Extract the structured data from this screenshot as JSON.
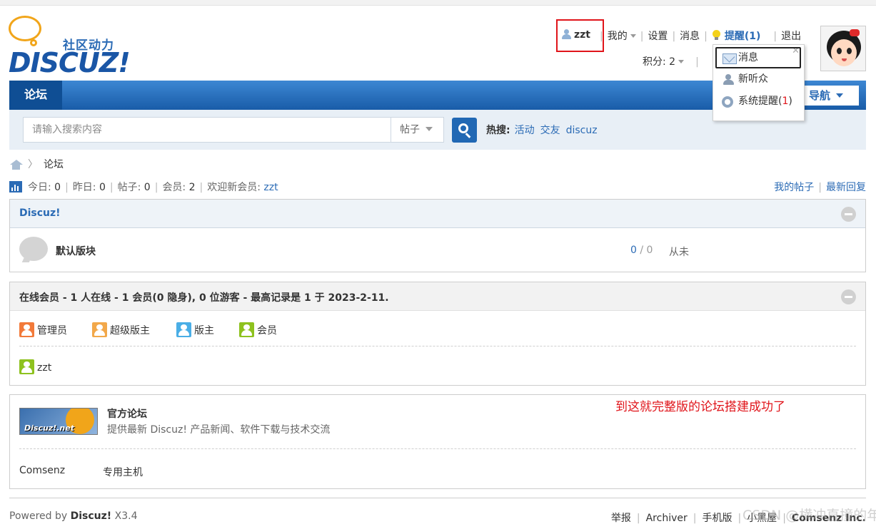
{
  "logo": {
    "slogan": "社区动力",
    "brand": "DISCUZ!"
  },
  "userbar": {
    "username": "zzt",
    "my": "我的",
    "settings": "设置",
    "messages": "消息",
    "remind": "提醒(1)",
    "logout": "退出",
    "credits": "积分: 2"
  },
  "dropdown": {
    "items": [
      {
        "label": "消息"
      },
      {
        "label": "新听众"
      },
      {
        "label": "系统提醒",
        "count_open": "(",
        "count": "1",
        "count_close": ")"
      }
    ]
  },
  "nav": {
    "active": "论坛",
    "quick_nav": "导航"
  },
  "search": {
    "placeholder": "请输入搜索内容",
    "type": "帖子",
    "hot_label": "热搜:",
    "hot": [
      "活动",
      "交友",
      "discuz"
    ]
  },
  "breadcrumb": {
    "current": "论坛"
  },
  "stats": {
    "today_label": "今日:",
    "today": "0",
    "yesterday_label": "昨日:",
    "yesterday": "0",
    "posts_label": "帖子:",
    "posts": "0",
    "members_label": "会员:",
    "members": "2",
    "newest_label": "欢迎新会员:",
    "newest": "zzt",
    "my_posts": "我的帖子",
    "latest_replies": "最新回复"
  },
  "category": {
    "title": "Discuz!",
    "forum": {
      "name": "默认版块",
      "threads": "0",
      "slash": " / ",
      "posts": "0",
      "last": "从未"
    }
  },
  "online": {
    "title": "在线会员 - 1 人在线 - 1 会员(0 隐身), 0 位游客 - 最高记录是 1 于 2023-2-11.",
    "legend": [
      {
        "label": "管理员",
        "color": "#f27a3a"
      },
      {
        "label": "超级版主",
        "color": "#f2a84a"
      },
      {
        "label": "版主",
        "color": "#4aaee6"
      },
      {
        "label": "会员",
        "color": "#8ec21f"
      }
    ],
    "user": "zzt"
  },
  "links": {
    "logo_text": "Discuz!.net",
    "name": "官方论坛",
    "desc": "提供最新 Discuz! 产品新闻、软件下载与技术交流",
    "text_links": [
      "Comsenz",
      "专用主机"
    ]
  },
  "annotation": "到这就完整版的论坛搭建成功了",
  "footer": {
    "powered": "Powered by",
    "product": "Discuz!",
    "version": "X3.4",
    "links": [
      "举报",
      "Archiver",
      "手机版",
      "小黑屋",
      "Comsenz Inc."
    ]
  },
  "watermark": "CSDN @横冲直撞的年华"
}
